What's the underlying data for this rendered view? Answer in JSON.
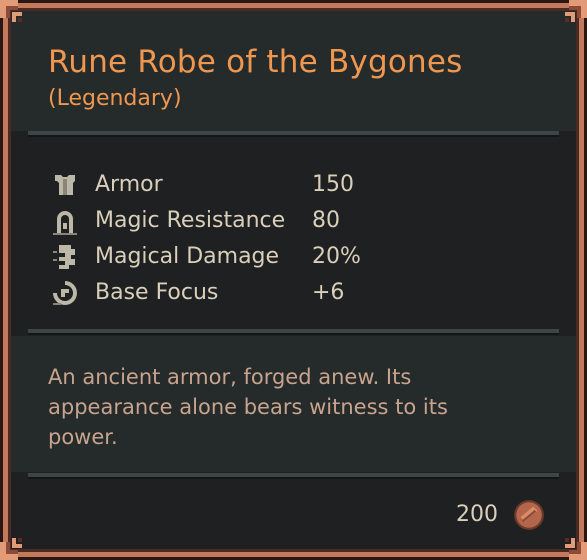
{
  "item": {
    "name": "Rune Robe of the Bygones",
    "rarity": "(Legendary)"
  },
  "stats": [
    {
      "icon": "armor-icon",
      "label": "Armor",
      "value": "150"
    },
    {
      "icon": "magic-resistance-icon",
      "label": "Magic Resistance",
      "value": "80"
    },
    {
      "icon": "magical-damage-icon",
      "label": "Magical Damage",
      "value": "20%"
    },
    {
      "icon": "base-focus-icon",
      "label": "Base Focus",
      "value": "+6"
    }
  ],
  "description": "An ancient armor, forged anew. Its appearance alone bears witness to its power.",
  "price": {
    "amount": "200",
    "icon": "coin-icon"
  },
  "colors": {
    "title": "#f0974f",
    "stat_text": "#d9cfba",
    "description": "#c8a48e",
    "border": "#c27a5c"
  }
}
